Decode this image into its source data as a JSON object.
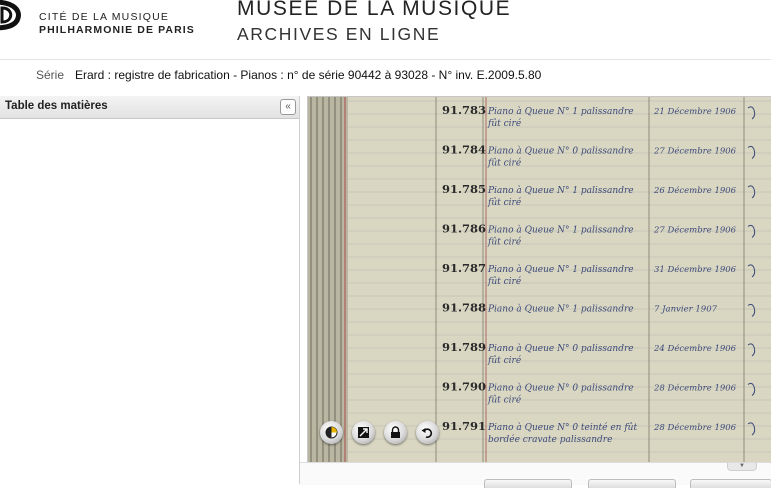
{
  "header": {
    "org_line1": "CITÉ DE LA MUSIQUE",
    "org_line2": "PHILHARMONIE DE PARIS",
    "museum_title": "MUSÉE DE LA MUSIQUE",
    "museum_subtitle": "ARCHIVES EN LIGNE"
  },
  "serie": {
    "label": "Série",
    "value": "Erard : registre de fabrication - Pianos : n° de série 90442 à 93028 - N° inv. E.2009.5.80"
  },
  "toc": {
    "title": "Table des matières",
    "collapse_glyph": "«"
  },
  "viewer": {
    "register_rows": [
      {
        "number": "91.783",
        "description": "Piano à Queue N° 1 palissandre",
        "description2": "fût ciré",
        "date": "21 Décembre 1906"
      },
      {
        "number": "91.784",
        "description": "Piano à Queue N° 0 palissandre",
        "description2": "fût ciré",
        "date": "27 Décembre 1906"
      },
      {
        "number": "91.785",
        "description": "Piano à Queue N° 1 palissandre",
        "description2": "fût ciré",
        "date": "26 Décembre 1906"
      },
      {
        "number": "91.786",
        "description": "Piano à Queue N° 1 palissandre",
        "description2": "fût ciré",
        "date": "27 Décembre 1906"
      },
      {
        "number": "91.787",
        "description": "Piano à Queue N° 1 palissandre",
        "description2": "fût ciré",
        "date": "31 Décembre 1906"
      },
      {
        "number": "91.788",
        "description": "Piano à Queue N° 1 palissandre",
        "description2": "",
        "date": "7 Janvier 1907"
      },
      {
        "number": "91.789",
        "description": "Piano à Queue N° 0 palissandre",
        "description2": "fût ciré",
        "date": "24 Décembre 1906"
      },
      {
        "number": "91.790",
        "description": "Piano à Queue N° 0 palissandre",
        "description2": "fût ciré",
        "date": "28 Décembre 1906"
      },
      {
        "number": "91.791",
        "description": "Piano à Queue N° 0 teinté en fût",
        "description2": "bordée cravate palissandre",
        "date": "28 Décembre 1906"
      }
    ],
    "tools": [
      "contrast-icon",
      "fit-page-icon",
      "lock-icon",
      "rotate-icon"
    ]
  },
  "colors": {
    "paper": "#d9d7c2",
    "ink": "#3d4a7a",
    "number_ink": "#2a2a2a",
    "rule_red": "#b06a62"
  }
}
